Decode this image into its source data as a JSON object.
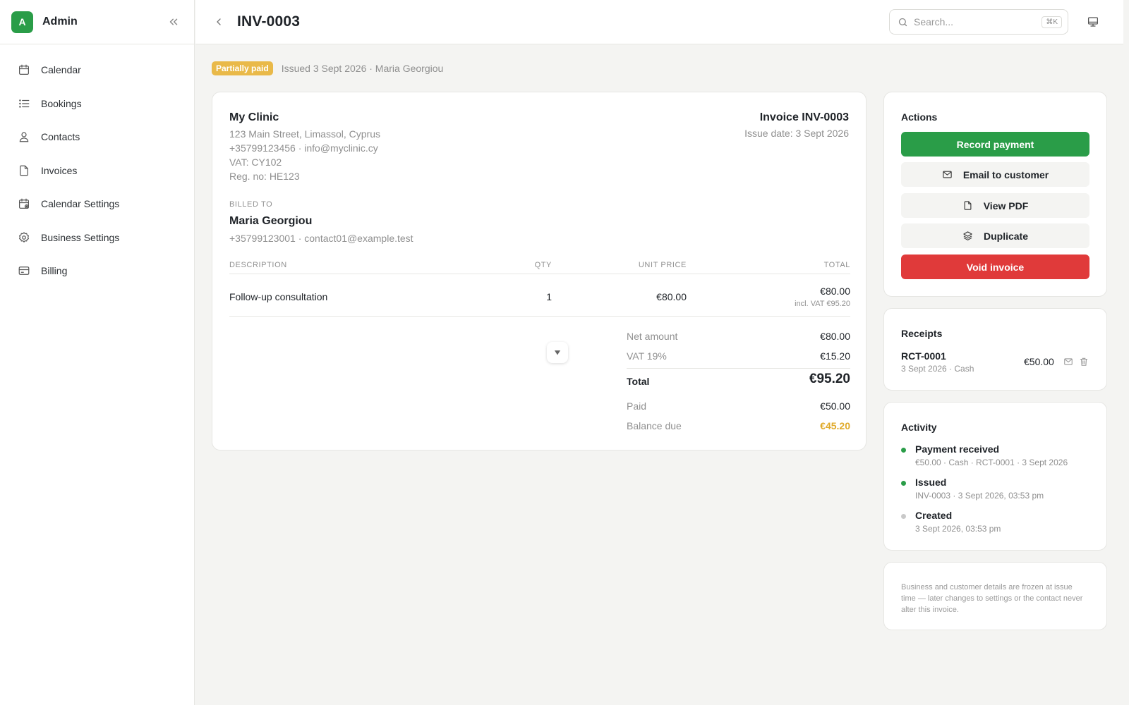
{
  "sidebar": {
    "logo_letter": "A",
    "title": "Admin",
    "items": [
      {
        "label": "Calendar",
        "icon": "calendar-icon"
      },
      {
        "label": "Bookings",
        "icon": "list-icon"
      },
      {
        "label": "Contacts",
        "icon": "user-icon"
      },
      {
        "label": "Invoices",
        "icon": "file-icon"
      },
      {
        "label": "Calendar Settings",
        "icon": "calendar-settings-icon"
      },
      {
        "label": "Business Settings",
        "icon": "gear-icon"
      },
      {
        "label": "Billing",
        "icon": "credit-card-icon"
      }
    ]
  },
  "header": {
    "title": "INV-0003",
    "search_placeholder": "Search...",
    "search_shortcut": "⌘K"
  },
  "status": {
    "badge": "Partially paid",
    "meta": "Issued 3 Sept 2026 · Maria Georgiou"
  },
  "invoice": {
    "business": {
      "name": "My Clinic",
      "address": "123 Main Street, Limassol, Cyprus",
      "contact": "+35799123456 · info@myclinic.cy",
      "vat": "VAT: CY102",
      "reg": "Reg. no: HE123"
    },
    "number_label": "Invoice INV-0003",
    "issue_date": "Issue date: 3 Sept 2026",
    "billed_to_label": "BILLED TO",
    "customer_name": "Maria Georgiou",
    "customer_contact": "+35799123001 · contact01@example.test",
    "columns": {
      "description": "DESCRIPTION",
      "qty": "QTY",
      "unit_price": "UNIT PRICE",
      "total": "TOTAL"
    },
    "lines": [
      {
        "description": "Follow-up consultation",
        "qty": "1",
        "unit_price": "€80.00",
        "total": "€80.00",
        "incl_vat": "incl. VAT €95.20"
      }
    ],
    "summary": {
      "net_label": "Net amount",
      "net_value": "€80.00",
      "vat_label": "VAT 19%",
      "vat_value": "€15.20",
      "total_label": "Total",
      "total_value": "€95.20",
      "paid_label": "Paid",
      "paid_value": "€50.00",
      "balance_label": "Balance due",
      "balance_value": "€45.20"
    }
  },
  "actions": {
    "title": "Actions",
    "record_payment": "Record payment",
    "email_customer": "Email to customer",
    "view_pdf": "View PDF",
    "duplicate": "Duplicate",
    "void_invoice": "Void invoice"
  },
  "receipts": {
    "title": "Receipts",
    "items": [
      {
        "id": "RCT-0001",
        "meta": "3 Sept 2026 · Cash",
        "amount": "€50.00"
      }
    ]
  },
  "activity": {
    "title": "Activity",
    "items": [
      {
        "title": "Payment received",
        "meta": "€50.00 · Cash · RCT-0001 · 3 Sept 2026",
        "dot_color": "#2a9d48"
      },
      {
        "title": "Issued",
        "meta": "INV-0003 · 3 Sept 2026, 03:53 pm",
        "dot_color": "#2a9d48"
      },
      {
        "title": "Created",
        "meta": "3 Sept 2026, 03:53 pm",
        "dot_color": "#c9c9c9"
      }
    ]
  },
  "note": {
    "text": "Business and customer details are frozen at issue time — later changes to settings or the contact never alter this invoice."
  },
  "colors": {
    "primary_green": "#2a9d48",
    "danger_red": "#e03a3a",
    "badge_amber": "#e9b949",
    "balance_amber": "#e0aa2a"
  }
}
